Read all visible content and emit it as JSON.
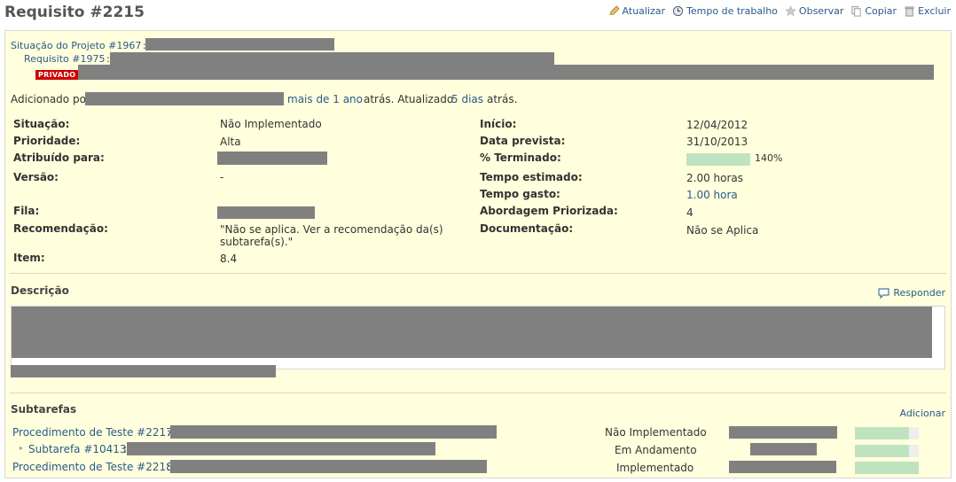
{
  "header": {
    "title": "Requisito #2215"
  },
  "actions": [
    {
      "label": "Atualizar",
      "icon": "edit-icon"
    },
    {
      "label": "Tempo de trabalho",
      "icon": "time-icon"
    },
    {
      "label": "Observar",
      "icon": "star-icon"
    },
    {
      "label": "Copiar",
      "icon": "copy-icon"
    },
    {
      "label": "Excluir",
      "icon": "trash-icon"
    }
  ],
  "parents": {
    "project_link": "Situação do Projeto #1967",
    "requirement_link": "Requisito #1975"
  },
  "private_badge": "PRIVADO",
  "meta": {
    "added_by": "Adicionado por",
    "added_ago": "mais de 1 ano",
    "ago1": "atrás. Atualizado",
    "updated_ago": "5 dias",
    "ago2": "atrás."
  },
  "attributes": {
    "status_label": "Situação:",
    "status_value": "Não Implementado",
    "priority_label": "Prioridade:",
    "priority_value": "Alta",
    "assigned_label": "Atribuído para:",
    "version_label": "Versão:",
    "version_value": "-",
    "queue_label": "Fila:",
    "recommendation_label": "Recomendação:",
    "recommendation_line1": "\"Não se aplica. Ver a recomendação da(s)",
    "recommendation_line2": "subtarefa(s).\"",
    "item_label": "Item:",
    "item_value": "8.4",
    "start_label": "Início:",
    "start_value": "12/04/2012",
    "due_label": "Data prevista:",
    "due_value": "31/10/2013",
    "done_label": "% Terminado:",
    "done_value": "140%",
    "done_fraction": 1.0,
    "estimated_label": "Tempo estimado:",
    "estimated_value": "2.00 horas",
    "spent_label": "Tempo gasto:",
    "spent_value": "1.00 hora",
    "approach_label": "Abordagem Priorizada:",
    "approach_value": "4",
    "documentation_label": "Documentação:",
    "documentation_value": "Não se Aplica"
  },
  "description": {
    "title": "Descrição",
    "reply_label": "Responder"
  },
  "subtasks": {
    "title": "Subtarefas",
    "add_label": "Adicionar",
    "rows": [
      {
        "link": "Procedimento de Teste #2217",
        "status": "Não Implementado",
        "progress": 0.85
      },
      {
        "link": "Subtarefa #10413",
        "status": "Em Andamento",
        "progress": 0.85
      },
      {
        "link": "Procedimento de Teste #2218",
        "status": "Implementado",
        "progress": 1.0
      }
    ]
  }
}
